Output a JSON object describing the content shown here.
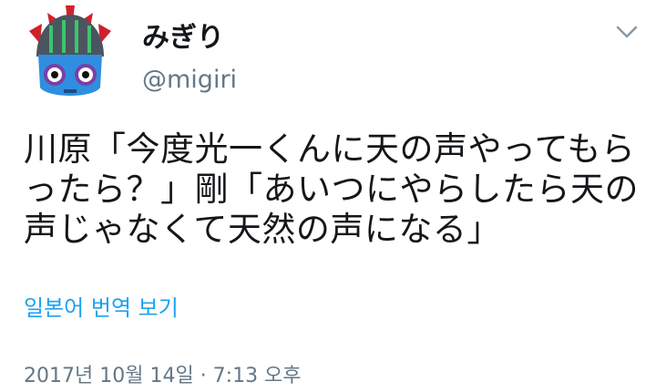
{
  "user": {
    "display_name": "みぎり",
    "handle": "@migiri",
    "avatar_icon": "masked-character-avatar-icon"
  },
  "menu": {
    "icon": "chevron-down-icon"
  },
  "tweet": {
    "text": "川原「今度光一くんに天の声やってもらったら？」剛「あいつにやらしたら天の声じゃなくて天然の声になる」",
    "translate_label": "일본어 번역 보기",
    "timestamp": "2017년 10월 14일 · 7:13 오후"
  },
  "colors": {
    "text_primary": "#14171a",
    "text_secondary": "#657786",
    "link": "#1da1f2"
  }
}
